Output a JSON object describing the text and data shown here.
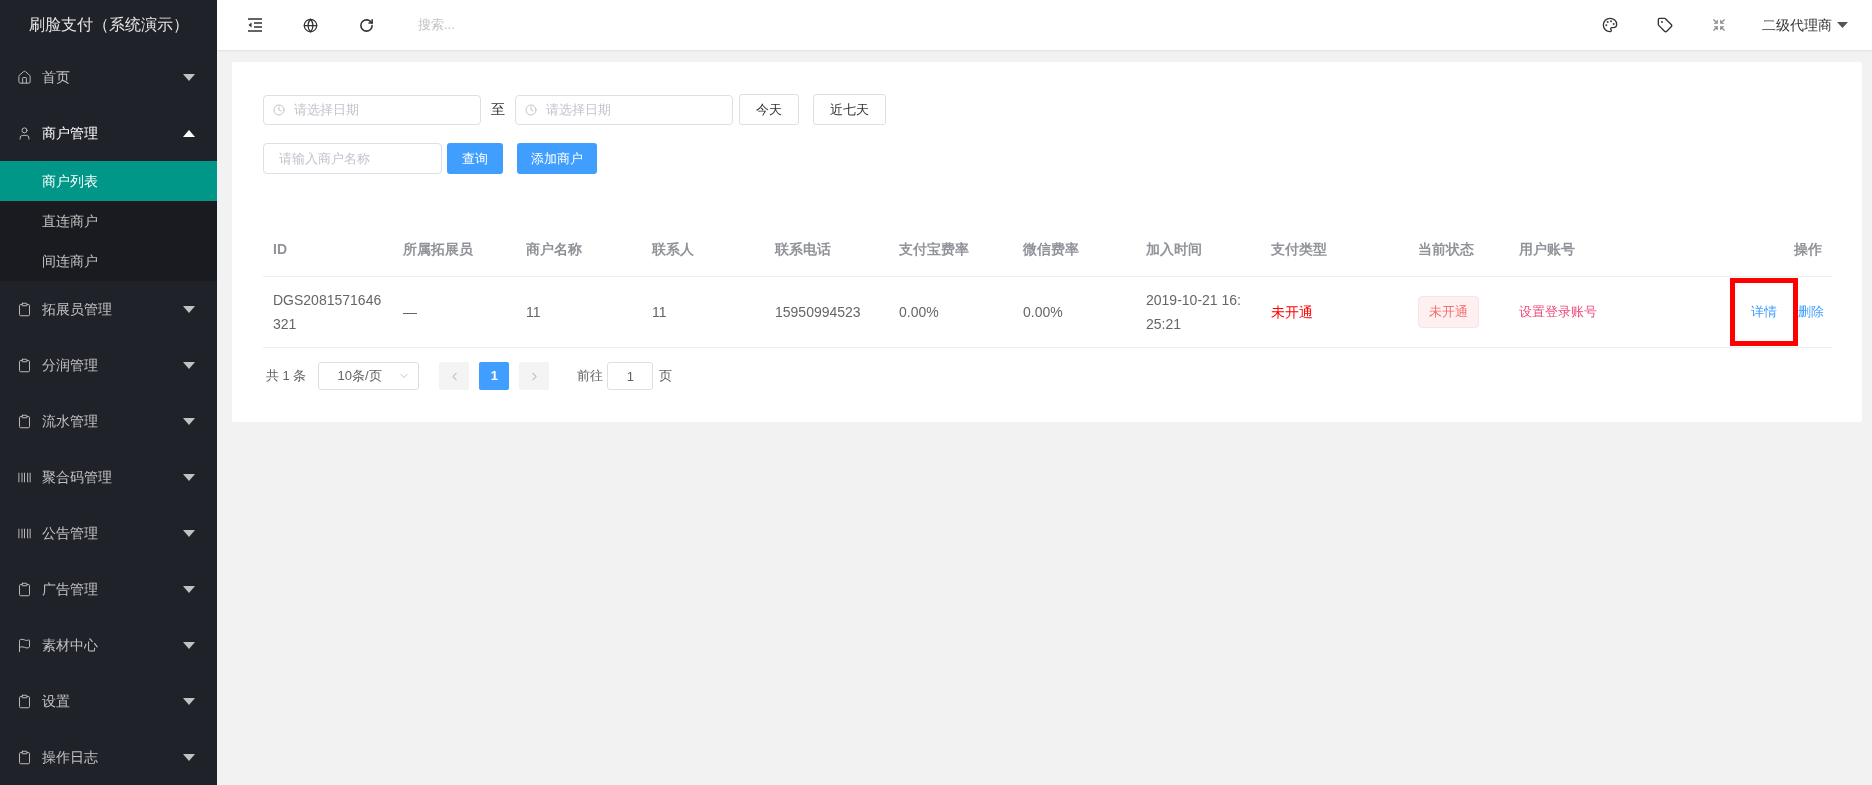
{
  "sidebar": {
    "title": "刷脸支付（系统演示）",
    "items": [
      {
        "label": "首页",
        "kind": "home",
        "expanded": false
      },
      {
        "label": "商户管理",
        "kind": "user",
        "expanded": true,
        "children": [
          {
            "label": "商户列表",
            "selected": true
          },
          {
            "label": "直连商户",
            "selected": false
          },
          {
            "label": "间连商户",
            "selected": false
          }
        ]
      },
      {
        "label": "拓展员管理",
        "kind": "clipboard",
        "expanded": false
      },
      {
        "label": "分润管理",
        "kind": "clipboard",
        "expanded": false
      },
      {
        "label": "流水管理",
        "kind": "clipboard",
        "expanded": false
      },
      {
        "label": "聚合码管理",
        "kind": "barcode",
        "expanded": false
      },
      {
        "label": "公告管理",
        "kind": "barcode",
        "expanded": false
      },
      {
        "label": "广告管理",
        "kind": "clipboard",
        "expanded": false
      },
      {
        "label": "素材中心",
        "kind": "flag",
        "expanded": false
      },
      {
        "label": "设置",
        "kind": "clipboard",
        "expanded": false
      },
      {
        "label": "操作日志",
        "kind": "clipboard",
        "expanded": false
      }
    ]
  },
  "header": {
    "search": {
      "placeholder": "搜索..."
    },
    "user": "二级代理商"
  },
  "filters": {
    "start_date": {
      "placeholder": "请选择日期"
    },
    "separator": "至",
    "end_date": {
      "placeholder": "请选择日期"
    },
    "quick_buttons": [
      "今天",
      "近七天"
    ],
    "merchant_name": {
      "placeholder": "请输入商户名称"
    },
    "query_button": "查询",
    "add_button": "添加商户"
  },
  "table": {
    "columns": [
      "ID",
      "所属拓展员",
      "商户名称",
      "联系人",
      "联系电话",
      "支付宝费率",
      "微信费率",
      "加入时间",
      "支付类型",
      "当前状态",
      "用户账号",
      "操作"
    ],
    "rows": [
      {
        "id": "DGS2081571646321",
        "promoter": "—",
        "name": "11",
        "contact": "11",
        "phone": "15950994523",
        "alipay_rate": "0.00%",
        "wechat_rate": "0.00%",
        "joined": "2019-10-21 16:25:21",
        "pay_type": "未开通",
        "status": "未开通",
        "account_link": "设置登录账号",
        "actions": [
          {
            "label": "详情",
            "highlighted": true
          },
          {
            "label": "删除",
            "highlighted": false
          }
        ]
      }
    ]
  },
  "pagination": {
    "total": "共 1 条",
    "page_size": "10条/页",
    "pages": [
      {
        "label": "1",
        "selected": true
      }
    ],
    "goto_label": "前往",
    "goto_value": "1",
    "page_suffix": "页"
  }
}
